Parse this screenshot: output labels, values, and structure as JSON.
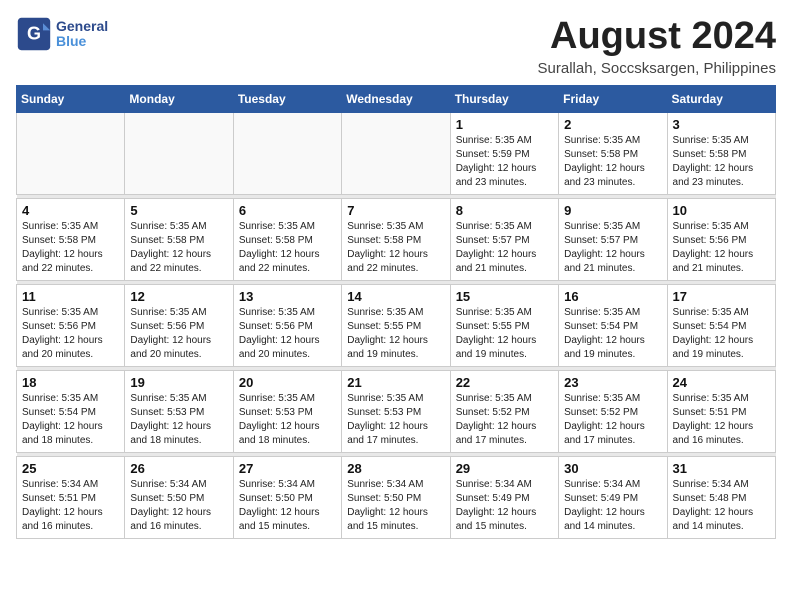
{
  "header": {
    "logo_line1": "General",
    "logo_line2": "Blue",
    "main_title": "August 2024",
    "subtitle": "Surallah, Soccsksargen, Philippines"
  },
  "days_of_week": [
    "Sunday",
    "Monday",
    "Tuesday",
    "Wednesday",
    "Thursday",
    "Friday",
    "Saturday"
  ],
  "weeks": [
    {
      "days": [
        {
          "num": "",
          "info": ""
        },
        {
          "num": "",
          "info": ""
        },
        {
          "num": "",
          "info": ""
        },
        {
          "num": "",
          "info": ""
        },
        {
          "num": "1",
          "info": "Sunrise: 5:35 AM\nSunset: 5:59 PM\nDaylight: 12 hours\nand 23 minutes."
        },
        {
          "num": "2",
          "info": "Sunrise: 5:35 AM\nSunset: 5:58 PM\nDaylight: 12 hours\nand 23 minutes."
        },
        {
          "num": "3",
          "info": "Sunrise: 5:35 AM\nSunset: 5:58 PM\nDaylight: 12 hours\nand 23 minutes."
        }
      ]
    },
    {
      "days": [
        {
          "num": "4",
          "info": "Sunrise: 5:35 AM\nSunset: 5:58 PM\nDaylight: 12 hours\nand 22 minutes."
        },
        {
          "num": "5",
          "info": "Sunrise: 5:35 AM\nSunset: 5:58 PM\nDaylight: 12 hours\nand 22 minutes."
        },
        {
          "num": "6",
          "info": "Sunrise: 5:35 AM\nSunset: 5:58 PM\nDaylight: 12 hours\nand 22 minutes."
        },
        {
          "num": "7",
          "info": "Sunrise: 5:35 AM\nSunset: 5:58 PM\nDaylight: 12 hours\nand 22 minutes."
        },
        {
          "num": "8",
          "info": "Sunrise: 5:35 AM\nSunset: 5:57 PM\nDaylight: 12 hours\nand 21 minutes."
        },
        {
          "num": "9",
          "info": "Sunrise: 5:35 AM\nSunset: 5:57 PM\nDaylight: 12 hours\nand 21 minutes."
        },
        {
          "num": "10",
          "info": "Sunrise: 5:35 AM\nSunset: 5:56 PM\nDaylight: 12 hours\nand 21 minutes."
        }
      ]
    },
    {
      "days": [
        {
          "num": "11",
          "info": "Sunrise: 5:35 AM\nSunset: 5:56 PM\nDaylight: 12 hours\nand 20 minutes."
        },
        {
          "num": "12",
          "info": "Sunrise: 5:35 AM\nSunset: 5:56 PM\nDaylight: 12 hours\nand 20 minutes."
        },
        {
          "num": "13",
          "info": "Sunrise: 5:35 AM\nSunset: 5:56 PM\nDaylight: 12 hours\nand 20 minutes."
        },
        {
          "num": "14",
          "info": "Sunrise: 5:35 AM\nSunset: 5:55 PM\nDaylight: 12 hours\nand 19 minutes."
        },
        {
          "num": "15",
          "info": "Sunrise: 5:35 AM\nSunset: 5:55 PM\nDaylight: 12 hours\nand 19 minutes."
        },
        {
          "num": "16",
          "info": "Sunrise: 5:35 AM\nSunset: 5:54 PM\nDaylight: 12 hours\nand 19 minutes."
        },
        {
          "num": "17",
          "info": "Sunrise: 5:35 AM\nSunset: 5:54 PM\nDaylight: 12 hours\nand 19 minutes."
        }
      ]
    },
    {
      "days": [
        {
          "num": "18",
          "info": "Sunrise: 5:35 AM\nSunset: 5:54 PM\nDaylight: 12 hours\nand 18 minutes."
        },
        {
          "num": "19",
          "info": "Sunrise: 5:35 AM\nSunset: 5:53 PM\nDaylight: 12 hours\nand 18 minutes."
        },
        {
          "num": "20",
          "info": "Sunrise: 5:35 AM\nSunset: 5:53 PM\nDaylight: 12 hours\nand 18 minutes."
        },
        {
          "num": "21",
          "info": "Sunrise: 5:35 AM\nSunset: 5:53 PM\nDaylight: 12 hours\nand 17 minutes."
        },
        {
          "num": "22",
          "info": "Sunrise: 5:35 AM\nSunset: 5:52 PM\nDaylight: 12 hours\nand 17 minutes."
        },
        {
          "num": "23",
          "info": "Sunrise: 5:35 AM\nSunset: 5:52 PM\nDaylight: 12 hours\nand 17 minutes."
        },
        {
          "num": "24",
          "info": "Sunrise: 5:35 AM\nSunset: 5:51 PM\nDaylight: 12 hours\nand 16 minutes."
        }
      ]
    },
    {
      "days": [
        {
          "num": "25",
          "info": "Sunrise: 5:34 AM\nSunset: 5:51 PM\nDaylight: 12 hours\nand 16 minutes."
        },
        {
          "num": "26",
          "info": "Sunrise: 5:34 AM\nSunset: 5:50 PM\nDaylight: 12 hours\nand 16 minutes."
        },
        {
          "num": "27",
          "info": "Sunrise: 5:34 AM\nSunset: 5:50 PM\nDaylight: 12 hours\nand 15 minutes."
        },
        {
          "num": "28",
          "info": "Sunrise: 5:34 AM\nSunset: 5:50 PM\nDaylight: 12 hours\nand 15 minutes."
        },
        {
          "num": "29",
          "info": "Sunrise: 5:34 AM\nSunset: 5:49 PM\nDaylight: 12 hours\nand 15 minutes."
        },
        {
          "num": "30",
          "info": "Sunrise: 5:34 AM\nSunset: 5:49 PM\nDaylight: 12 hours\nand 14 minutes."
        },
        {
          "num": "31",
          "info": "Sunrise: 5:34 AM\nSunset: 5:48 PM\nDaylight: 12 hours\nand 14 minutes."
        }
      ]
    }
  ]
}
